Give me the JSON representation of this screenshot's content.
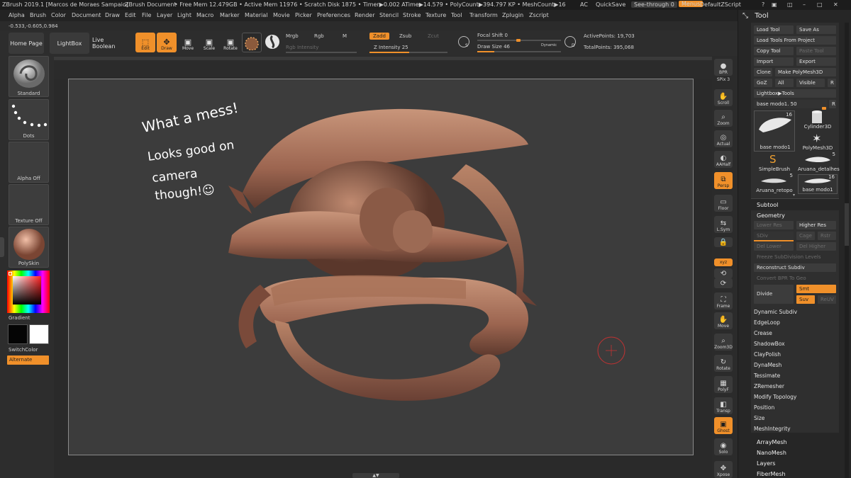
{
  "titlebar": {
    "app": "ZBrush 2019.1 [Marcos de Moraes Sampaio]",
    "doc": "ZBrush Document",
    "stats": "• Free Mem 12.479GB • Active Mem 11976 • Scratch Disk 1875 • Timer▶0.002 ATime▶14.579 • PolyCount▶394.797 KP • MeshCount▶16",
    "ac": "AC",
    "quicksave": "QuickSave",
    "seethrough": "See-through  0",
    "menus": "Menus",
    "script": "DefaultZScript"
  },
  "menubar": [
    "Alpha",
    "Brush",
    "Color",
    "Document",
    "Draw",
    "Edit",
    "File",
    "Layer",
    "Light",
    "Macro",
    "Marker",
    "Material",
    "Movie",
    "Picker",
    "Preferences",
    "Render",
    "Stencil",
    "Stroke",
    "Texture",
    "Tool",
    "Transform",
    "Zplugin",
    "Zscript"
  ],
  "coords": "-0.533,-0.605,0.984",
  "shelf": {
    "home": "Home Page",
    "lightbox": "LightBox",
    "liveboolean": "Live Boolean",
    "tools": [
      {
        "label": "Edit",
        "icon": "edit-icon",
        "glyph": "⬚"
      },
      {
        "label": "Draw",
        "icon": "draw-icon",
        "glyph": "✎"
      },
      {
        "label": "Move",
        "icon": "move-icon",
        "glyph": "✥"
      },
      {
        "label": "Scale",
        "icon": "scale-icon",
        "glyph": "⤢"
      },
      {
        "label": "Rotate",
        "icon": "rotate-icon",
        "glyph": "↻"
      }
    ],
    "mrgb": "Mrgb",
    "rgb": "Rgb",
    "m": "M",
    "rgb_intensity": "Rgb Intensity",
    "zadd": "Zadd",
    "zsub": "Zsub",
    "zcut": "Zcut",
    "z_intensity": "Z Intensity 25",
    "focal_shift": "Focal Shift 0",
    "draw_size": "Draw Size 46",
    "dynamic": "Dynamic",
    "active_points": "ActivePoints: 19,703",
    "total_points": "TotalPoints: 395,068"
  },
  "left": {
    "brush": "Standard",
    "stroke": "Dots",
    "alpha": "Alpha Off",
    "texture": "Texture Off",
    "material": "PolySkin",
    "gradient": "Gradient",
    "switchcolor": "SwitchColor",
    "alternate": "Alternate"
  },
  "canvas": {
    "note": [
      "What a mess!",
      "Looks good on",
      "camera",
      "though!☺"
    ]
  },
  "rightstrip": [
    {
      "label": "BPR",
      "icon": "bpr-icon"
    },
    {
      "label": "SPix 3",
      "icon": ""
    },
    {
      "label": "Scroll",
      "icon": "scroll-icon"
    },
    {
      "label": "Zoom",
      "icon": "zoom-icon"
    },
    {
      "label": "Actual",
      "icon": "actual-icon"
    },
    {
      "label": "AAHalf",
      "icon": "aahalf-icon"
    },
    {
      "label": "Persp",
      "icon": "persp-icon"
    },
    {
      "label": "Floor",
      "icon": "floor-icon"
    },
    {
      "label": "L.Sym",
      "icon": "lsym-icon"
    },
    {
      "label": "",
      "icon": "lock-icon"
    },
    {
      "label": "xyz",
      "icon": ""
    },
    {
      "label": "",
      "icon": "rotate-y-icon"
    },
    {
      "label": "",
      "icon": "rotate-z-icon"
    },
    {
      "label": "Frame",
      "icon": "frame-icon"
    },
    {
      "label": "Move",
      "icon": "move-icon"
    },
    {
      "label": "Zoom3D",
      "icon": "zoom3d-icon"
    },
    {
      "label": "Rotate",
      "icon": "rotate-icon"
    },
    {
      "label": "PolyF",
      "icon": "polyf-icon"
    },
    {
      "label": "Transp",
      "icon": "transp-icon"
    },
    {
      "label": "Ghost",
      "icon": "ghost-icon"
    },
    {
      "label": "Solo",
      "icon": "solo-icon"
    },
    {
      "label": "Xpose",
      "icon": "xpose-icon"
    }
  ],
  "tool": {
    "header": "Tool",
    "load_tool": "Load Tool",
    "save_as": "Save As",
    "load_from_project": "Load Tools From Project",
    "copy_tool": "Copy Tool",
    "paste_tool": "Paste Tool",
    "import": "Import",
    "export": "Export",
    "clone": "Clone",
    "make_polymesh": "Make PolyMesh3D",
    "goz": "GoZ",
    "all": "All",
    "visible": "Visible",
    "r": "R",
    "lightbox_tools": "Lightbox▶Tools",
    "current_tool": "base modo1. 50",
    "thumbs": [
      {
        "name": "base modo1",
        "count": "16"
      },
      {
        "name": "Cylinder3D",
        "count": ""
      },
      {
        "name": "PolyMesh3D",
        "count": ""
      },
      {
        "name": "SimpleBrush",
        "count": ""
      },
      {
        "name": "Aruana_detalhes",
        "count": "5"
      },
      {
        "name": "Aruana_retopo",
        "count": "5"
      },
      {
        "name": "base modo1",
        "count": "16"
      }
    ],
    "subtool": "Subtool",
    "geometry": "Geometry",
    "lower_res": "Lower Res",
    "higher_res": "Higher Res",
    "sdiv": "SDiv",
    "cage": "Cage",
    "rstr": "Rstr",
    "del_lower": "Del Lower",
    "del_higher": "Del Higher",
    "freeze": "Freeze SubDivision Levels",
    "reconstruct": "Reconstruct Subdiv",
    "convert_bpr": "Convert BPR To Geo",
    "divide": "Divide",
    "smt": "Smt",
    "suv": "Suv",
    "reuv": "ReUV",
    "items": [
      "Dynamic Subdiv",
      "EdgeLoop",
      "Crease",
      "ShadowBox",
      "ClayPolish",
      "DynaMesh",
      "Tessimate",
      "ZRemesher",
      "Modify Topology",
      "Position",
      "Size",
      "MeshIntegrity"
    ],
    "sections": [
      "ArrayMesh",
      "NanoMesh",
      "Layers",
      "FiberMesh"
    ]
  }
}
